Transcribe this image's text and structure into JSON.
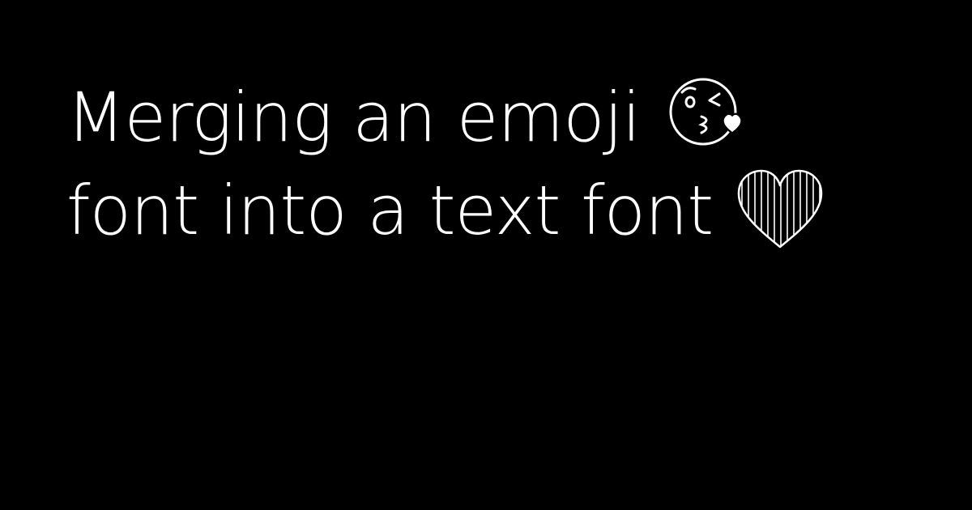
{
  "title": {
    "line1": "Merging an emoji",
    "line2": "font into a text font",
    "icons": [
      "kissing-face-icon",
      "striped-heart-icon"
    ]
  },
  "colors": {
    "background": "#000000",
    "foreground": "#ffffff"
  }
}
